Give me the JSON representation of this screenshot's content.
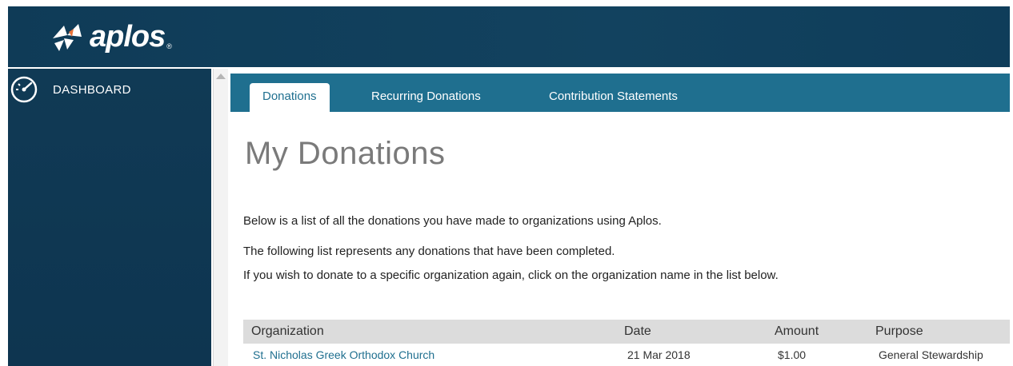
{
  "app": {
    "logo_text": "aplos",
    "logo_mark": "®",
    "brand_accent": "#e8743b"
  },
  "sidebar": {
    "items": [
      {
        "label": "DASHBOARD",
        "icon": "speedometer-icon"
      }
    ]
  },
  "tabs": [
    {
      "label": "Donations",
      "active": true
    },
    {
      "label": "Recurring Donations",
      "active": false
    },
    {
      "label": "Contribution Statements",
      "active": false
    }
  ],
  "main": {
    "title": "My Donations",
    "paragraphs": [
      "Below is a list of all the donations you have made to organizations using Aplos.",
      "The following list represents any donations that have been completed.",
      "If you wish to donate to a specific organization again, click on the organization name in the list below."
    ]
  },
  "table": {
    "columns": [
      "Organization",
      "Date",
      "Amount",
      "Purpose"
    ],
    "rows": [
      [
        "St. Nicholas Greek Orthodox Church",
        "21 Mar 2018",
        "$1.00",
        "General Stewardship"
      ]
    ]
  }
}
